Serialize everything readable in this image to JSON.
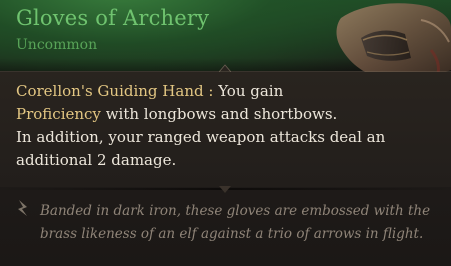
{
  "item": {
    "title": "Gloves of Archery",
    "rarity": "Uncommon",
    "ability_name": "Corellon's Guiding Hand",
    "ability_separator": " : ",
    "ability_text_1": "You gain",
    "term": "Proficiency",
    "ability_text_2": " with longbows and shortbows.",
    "ability_text_3": "In addition, your ranged weapon attacks deal an additional 2 damage.",
    "flavor": "Banded in dark iron, these gloves are embossed with the brass likeness of an elf against a trio of arrows in flight."
  },
  "icons": {
    "flavor": "quill-flourish-icon",
    "art": "leather-glove-icon"
  },
  "colors": {
    "rarity_green": "#6fc36f",
    "highlight_gold": "#e3c783",
    "body_text": "#ece6da",
    "flavor_text": "#8f8478"
  }
}
